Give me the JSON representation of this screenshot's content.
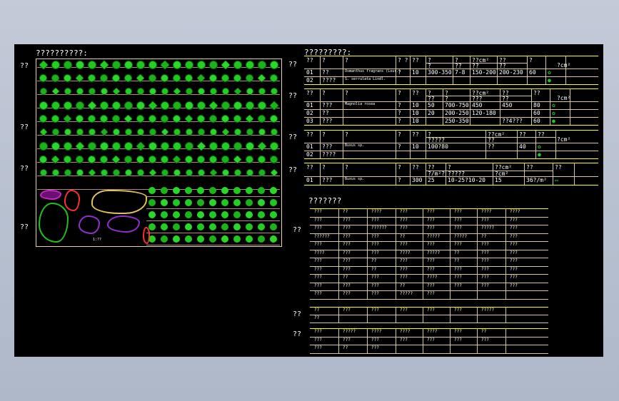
{
  "drawing": {
    "legend_title": "??????????:",
    "left_labels": [
      "??",
      "??",
      "??",
      "??"
    ],
    "tables_title": "?????????:",
    "right_labels": [
      "??",
      "??",
      "??",
      "??"
    ],
    "lower_title": "???????",
    "lower_labels": [
      "??",
      "??",
      "??"
    ],
    "scale_text": "1:??",
    "symbol_colors": [
      "#1ec81e",
      "#22d022",
      "#18b418",
      "#2ad82a"
    ],
    "blob_colors": {
      "magenta": "#d020d0",
      "red": "#ff3030",
      "yellow": "#e0c060",
      "green": "#20c020",
      "purple": "#9030d0"
    }
  },
  "table1": {
    "header": [
      "??",
      "?",
      "?",
      "?  ?",
      "??",
      "?",
      "?",
      "??cm²",
      "??",
      "?"
    ],
    "subheader": [
      "?",
      "??",
      "??",
      "??"
    ],
    "hdr_cm": "?cm²",
    "rows": [
      [
        "01",
        "??",
        "Osmanthus fragrans (Lour.)",
        "?",
        "10",
        "300-350",
        "7-8",
        "150-200",
        "200-230",
        "60",
        "✿"
      ],
      [
        "02",
        "????",
        "S. serrulata Lindl.",
        "",
        "",
        "",
        "",
        "",
        "",
        "",
        "●"
      ]
    ]
  },
  "table2": {
    "header": [
      "??",
      "?",
      "?",
      "?",
      "??",
      "?",
      "?",
      "??cm²",
      "??",
      "??"
    ],
    "subheader": [
      "??",
      "?",
      "???",
      "??"
    ],
    "hdr_cm": "?cm²",
    "rows": [
      [
        "01",
        "???",
        "Magnolia rosea",
        "?",
        "10",
        "50",
        "700-750",
        "450",
        "450",
        "80",
        "✿"
      ],
      [
        "02",
        "??",
        "",
        "?",
        "10",
        "20",
        "200-250",
        "120-180",
        "",
        "60",
        "✿"
      ],
      [
        "03",
        "???",
        "",
        "?",
        "10",
        "",
        "250-350",
        "",
        "??4???",
        "60",
        "●"
      ]
    ]
  },
  "table3": {
    "header": [
      "??",
      "?",
      "?",
      "?",
      "??",
      "?",
      "??cm²",
      "??",
      "??"
    ],
    "subheader": [
      "?????",
      "??"
    ],
    "hdr_cm": "?cm²",
    "rows": [
      [
        "01",
        "???",
        "Buxus sp.",
        "?",
        "10",
        "100?80",
        "??",
        "40",
        "✿"
      ],
      [
        "02",
        "????",
        "",
        "",
        "",
        "",
        "",
        "",
        "●"
      ]
    ]
  },
  "table4": {
    "header": [
      "??",
      "?",
      "?",
      "?",
      "??",
      "??",
      "?",
      "??cm²",
      "??",
      "??"
    ],
    "subheader": [
      "?/m²?",
      "?????",
      "?cm²"
    ],
    "rows": [
      [
        "01",
        "???",
        "Buxus sp.",
        "?",
        "300",
        "25",
        "10-25?10-20",
        "15",
        "36?/m²",
        "▭"
      ]
    ]
  },
  "list1": {
    "rows": [
      [
        "???",
        "??",
        "????",
        "???",
        "???",
        "???",
        "????",
        "????"
      ],
      [
        "???",
        "???",
        "???",
        "???",
        "???",
        "???",
        "???",
        "???"
      ],
      [
        "???",
        "???",
        "??????",
        "???",
        "???",
        "???",
        "?????",
        "???"
      ],
      [
        "??????",
        "???",
        "???",
        "??",
        "?????",
        "?????",
        "??",
        "???"
      ],
      [
        "???",
        "???",
        "???",
        "???",
        "???",
        "???",
        "???",
        "???"
      ],
      [
        "????",
        "???",
        "???",
        "????",
        "?????",
        "??",
        "???",
        "???"
      ],
      [
        "???",
        "???",
        "??",
        "???",
        "???",
        "??",
        "???",
        "???"
      ],
      [
        "???",
        "???",
        "??",
        "???",
        "???",
        "???",
        "???",
        "???"
      ],
      [
        "???",
        "??",
        "???",
        "???",
        "????",
        "???",
        "???",
        "???"
      ],
      [
        "???",
        "???",
        "???",
        "??",
        "???",
        "???",
        "???",
        "???"
      ],
      [
        "???",
        "???",
        "???",
        "?????",
        "???",
        "",
        "",
        ""
      ]
    ]
  },
  "list2": {
    "rows": [
      [
        "??",
        "???",
        "???",
        "???",
        "???",
        "???",
        "?????",
        ""
      ],
      [
        "??",
        "",
        "",
        "",
        "",
        "",
        "",
        ""
      ]
    ]
  },
  "list3": {
    "rows": [
      [
        "???",
        "?????",
        "????",
        "????",
        "????",
        "???",
        "??",
        ""
      ],
      [
        "???",
        "???",
        "???",
        "???",
        "???",
        "???",
        "???",
        ""
      ],
      [
        "???",
        "??",
        "???",
        "",
        "",
        "",
        "",
        ""
      ]
    ]
  }
}
